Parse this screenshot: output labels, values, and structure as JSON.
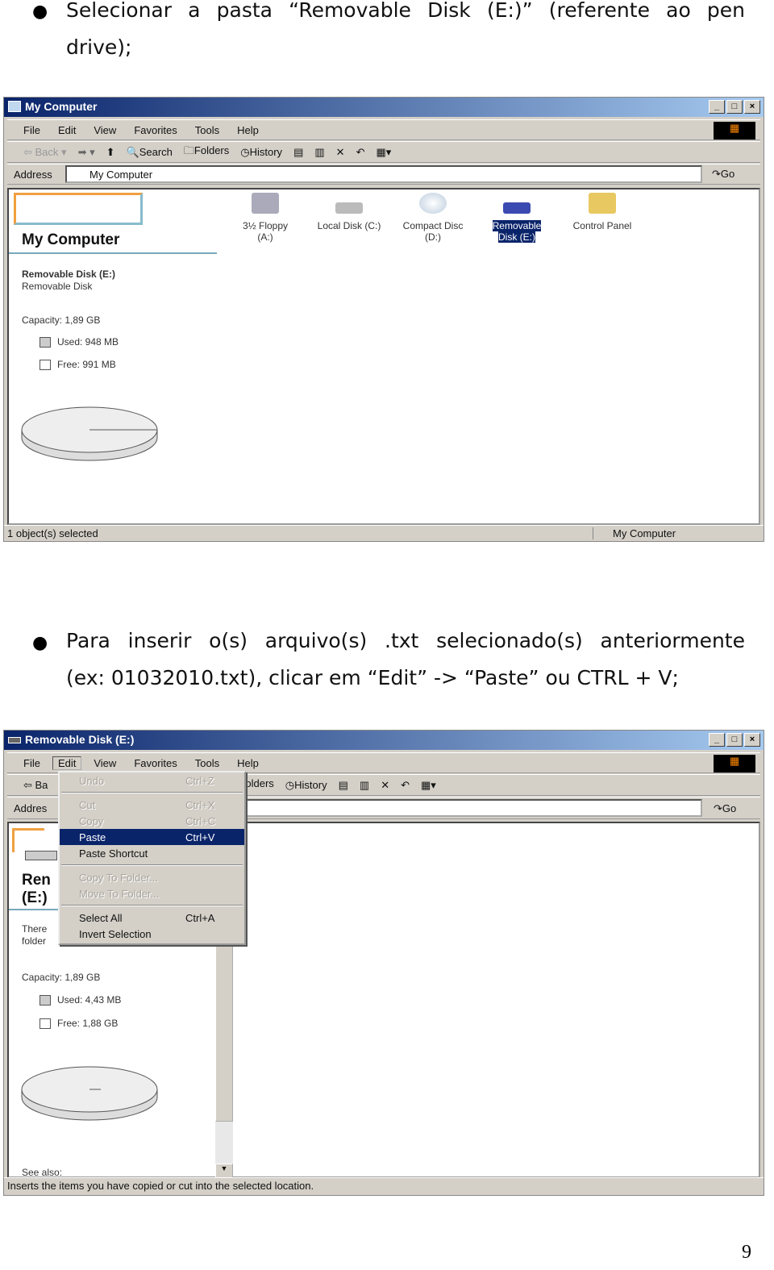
{
  "step1": {
    "text_line1": "Selecionar a pasta “Removable Disk (E:)” (referente ao pen",
    "text_line2": "drive);"
  },
  "step2": {
    "text_line1": "Para inserir o(s) arquivo(s) .txt selecionado(s) anteriormente",
    "text_line2": "(ex: 01032010.txt), clicar em “Edit” -> “Paste” ou CTRL + V;"
  },
  "page_number": "9",
  "menu_items": [
    "File",
    "Edit",
    "View",
    "Favorites",
    "Tools",
    "Help"
  ],
  "toolbar": {
    "back": "Back",
    "search": "Search",
    "folders": "Folders",
    "history": "History",
    "go": "Go"
  },
  "address_label": "Address",
  "window1": {
    "title": "My Computer",
    "address": "My Computer",
    "panel_title": "My Computer",
    "selected_name": "Removable Disk (E:)",
    "selected_type": "Removable Disk",
    "capacity": "Capacity: 1,89 GB",
    "used": "Used: 948 MB",
    "free": "Free: 991 MB",
    "drives": [
      {
        "l1": "3½ Floppy",
        "l2": "(A:)"
      },
      {
        "l1": "Local Disk (C:)",
        "l2": ""
      },
      {
        "l1": "Compact Disc",
        "l2": "(D:)"
      },
      {
        "l1": "Removable",
        "l2": "Disk (E:)"
      },
      {
        "l1": "Control Panel",
        "l2": ""
      }
    ],
    "status_left": "1 object(s) selected",
    "status_right": "My Computer"
  },
  "window2": {
    "title": "Removable Disk (E:)",
    "panel_title_l1": "Ren",
    "panel_title_l2": "(E:)",
    "desc_l1": "There",
    "desc_l2": "folder",
    "capacity": "Capacity: 1,89 GB",
    "used": "Used: 4,43 MB",
    "free": "Free: 1,88 GB",
    "see_also": "See also:",
    "back_partial": "Ba",
    "address_partial": "Addres",
    "status": "Inserts the items you have copied or cut into the selected location.",
    "edit_menu": [
      {
        "label": "Undo",
        "shortcut": "Ctrl+Z",
        "disabled": true
      },
      {
        "label": "Cut",
        "shortcut": "Ctrl+X",
        "disabled": true
      },
      {
        "label": "Copy",
        "shortcut": "Ctrl+C",
        "disabled": true
      },
      {
        "label": "Paste",
        "shortcut": "Ctrl+V",
        "highlighted": true
      },
      {
        "label": "Paste Shortcut",
        "shortcut": ""
      },
      {
        "label": "Copy To Folder...",
        "shortcut": "",
        "disabled": true
      },
      {
        "label": "Move To Folder...",
        "shortcut": "",
        "disabled": true
      },
      {
        "label": "Select All",
        "shortcut": "Ctrl+A"
      },
      {
        "label": "Invert Selection",
        "shortcut": ""
      }
    ]
  }
}
